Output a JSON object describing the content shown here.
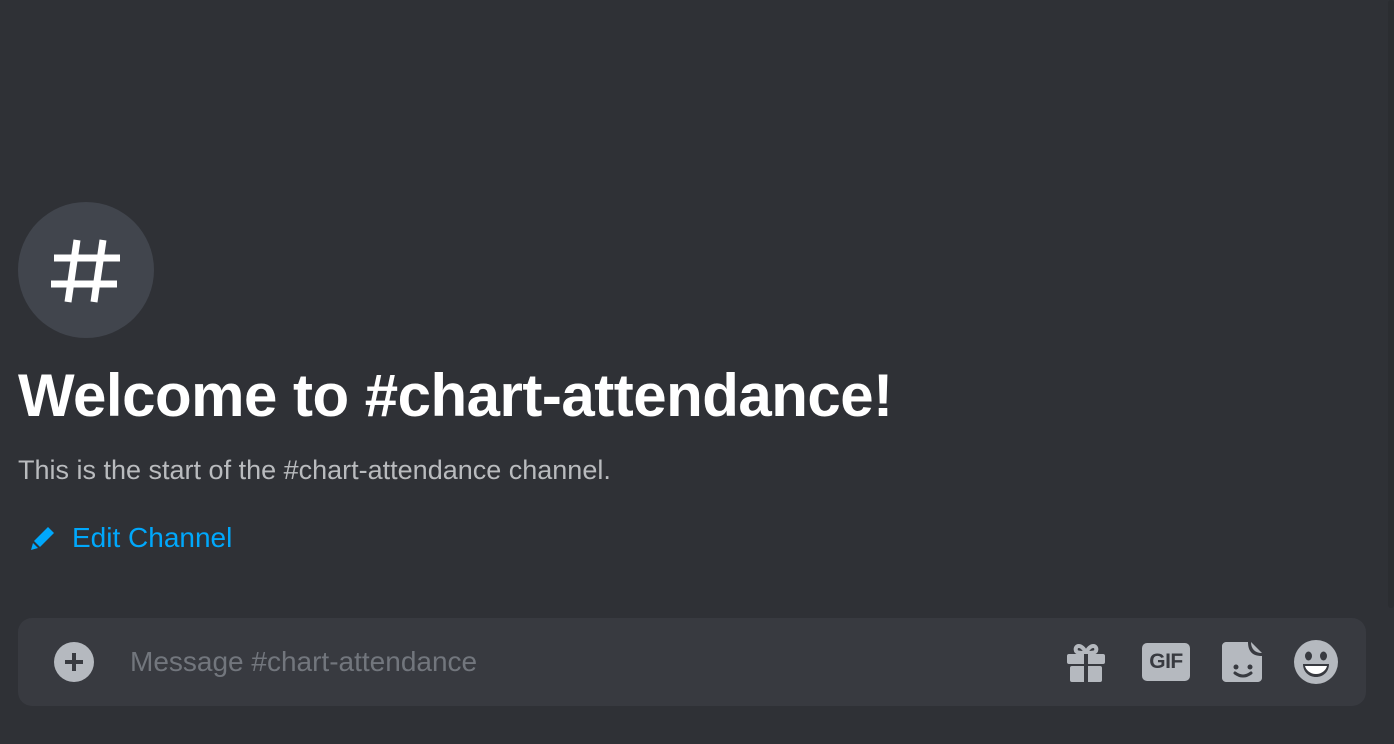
{
  "channel": {
    "hash_symbol": "#",
    "welcome_title": "Welcome to #chart-attendance!",
    "welcome_subtitle": "This is the start of the #chart-attendance channel.",
    "edit_label": "Edit Channel"
  },
  "composer": {
    "placeholder": "Message #chart-attendance",
    "value": "",
    "gif_label": "GIF",
    "icons": [
      "plus-circle-icon",
      "gift-icon",
      "gif-icon",
      "sticker-icon",
      "emoji-icon"
    ]
  },
  "colors": {
    "background": "#2f3136",
    "composer_bg": "#383a40",
    "hash_circle": "#41454d",
    "link": "#00a8fc",
    "muted_text": "#b9bbbe",
    "icon": "#b5b9bf"
  }
}
